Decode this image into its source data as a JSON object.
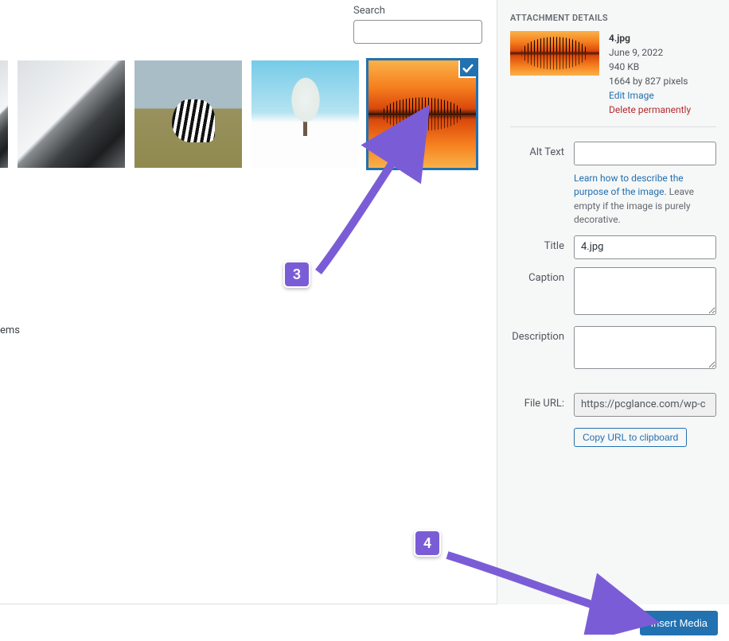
{
  "search": {
    "label": "Search",
    "value": ""
  },
  "thumbnails": [
    {
      "name": "image-thumb-0",
      "icon": "photo-partial"
    },
    {
      "name": "image-thumb-rocks",
      "icon": "rocks"
    },
    {
      "name": "image-thumb-zebra",
      "icon": "zebra"
    },
    {
      "name": "image-thumb-snowtree",
      "icon": "snow-tree"
    },
    {
      "name": "image-thumb-sunset",
      "icon": "sunset",
      "selected": true
    }
  ],
  "items_stub": "ems",
  "sidebar": {
    "title": "ATTACHMENT DETAILS",
    "filename": "4.jpg",
    "date": "June 9, 2022",
    "size": "940 KB",
    "dimensions": "1664 by 827 pixels",
    "edit_label": "Edit Image",
    "delete_label": "Delete permanently",
    "fields": {
      "alt_label": "Alt Text",
      "alt_value": "",
      "alt_help_link": "Learn how to describe the purpose of the image",
      "alt_help_rest": ". Leave empty if the image is purely decorative.",
      "title_label": "Title",
      "title_value": "4.jpg",
      "caption_label": "Caption",
      "caption_value": "",
      "description_label": "Description",
      "description_value": "",
      "fileurl_label": "File URL:",
      "fileurl_value": "https://pcglance.com/wp-c",
      "copy_label": "Copy URL to clipboard"
    }
  },
  "footer": {
    "insert_label": "Insert Media"
  },
  "annotations": {
    "step3": "3",
    "step4": "4"
  }
}
